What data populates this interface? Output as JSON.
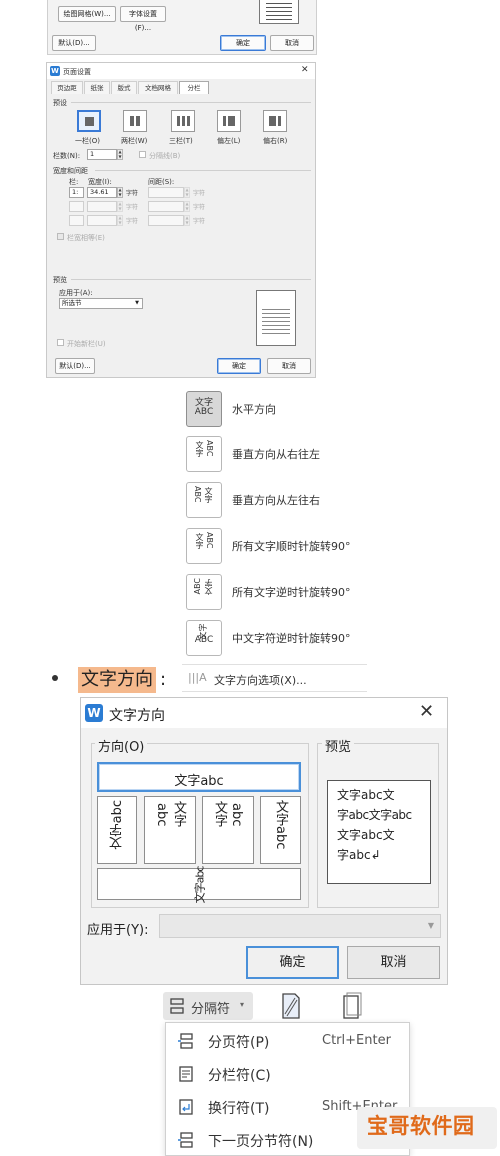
{
  "top_dialog": {
    "btn_grid": "绘图网格(W)...",
    "btn_font": "字体设置(F)...",
    "btn_default": "默认(D)...",
    "btn_ok": "确定",
    "btn_cancel": "取消"
  },
  "page_setup": {
    "title": "页面设置",
    "tabs": [
      "页边距",
      "纸张",
      "版式",
      "文档网格",
      "分栏"
    ],
    "presets_label": "预设",
    "presets": [
      "一栏(O)",
      "两栏(W)",
      "三栏(T)",
      "偏左(L)",
      "偏右(R)"
    ],
    "num_cols_label": "栏数(N):",
    "num_cols_value": "1",
    "separator_label": "分隔线(B)",
    "width_spacing_label": "宽度和间距",
    "col_label": "栏:",
    "width_label": "宽度(I):",
    "spacing_label": "间距(S):",
    "row1_col": "1:",
    "row1_width": "34.61",
    "unit": "字符",
    "equal_width_label": "栏宽相等(E)",
    "preview_label": "预览",
    "apply_to_label": "应用于(A):",
    "apply_to_value": "所选节",
    "new_col_label": "开始新栏(U)",
    "btn_default": "默认(D)...",
    "btn_ok": "确定",
    "btn_cancel": "取消"
  },
  "direction_menu": {
    "items": [
      {
        "label": "水平方向",
        "icon": "horizontal-text-icon"
      },
      {
        "label": "垂直方向从右往左",
        "icon": "vertical-rtl-icon"
      },
      {
        "label": "垂直方向从左往右",
        "icon": "vertical-ltr-icon"
      },
      {
        "label": "所有文字顺时针旋转90°",
        "icon": "rotate-cw-icon"
      },
      {
        "label": "所有文字逆时针旋转90°",
        "icon": "rotate-ccw-icon"
      },
      {
        "label": "中文字符逆时针旋转90°",
        "icon": "rotate-cjk-ccw-icon"
      }
    ],
    "icon_text": {
      "h1": "文字",
      "h2": "ABC",
      "v1": "文字",
      "v2": "ABC"
    }
  },
  "bullet_line": {
    "highlight": "文字方向",
    "colon": ":",
    "option_label": "文字方向选项(X)..."
  },
  "direction_dialog": {
    "title": "文字方向",
    "direction_group": "方向(O)",
    "preview_group": "预览",
    "opt_horizontal": "文字abc",
    "opt_v1": "文字abc",
    "opt_v2a": "文字",
    "opt_v2b": "abc",
    "opt_v3a": "文字",
    "opt_v3b": "abc",
    "opt_v4": "文字abc",
    "opt_bottom": "abc",
    "preview_lines": [
      "文字abc文",
      "字abc文字abc",
      "文字abc文",
      "字abc"
    ],
    "apply_to_label": "应用于(Y):",
    "btn_ok": "确定",
    "btn_cancel": "取消"
  },
  "separator_menu": {
    "button_label": "分隔符",
    "items": [
      {
        "label": "分页符(P)",
        "shortcut": "Ctrl+Enter"
      },
      {
        "label": "分栏符(C)",
        "shortcut": ""
      },
      {
        "label": "换行符(T)",
        "shortcut": "Shift+Enter"
      },
      {
        "label": "下一页分节符(N)",
        "shortcut": ""
      }
    ]
  },
  "watermark": {
    "text": "宝哥软件园"
  },
  "colors": {
    "accent": "#2b7cd3",
    "highlight": "#f5b98d",
    "watermark": "#e06a1a"
  }
}
